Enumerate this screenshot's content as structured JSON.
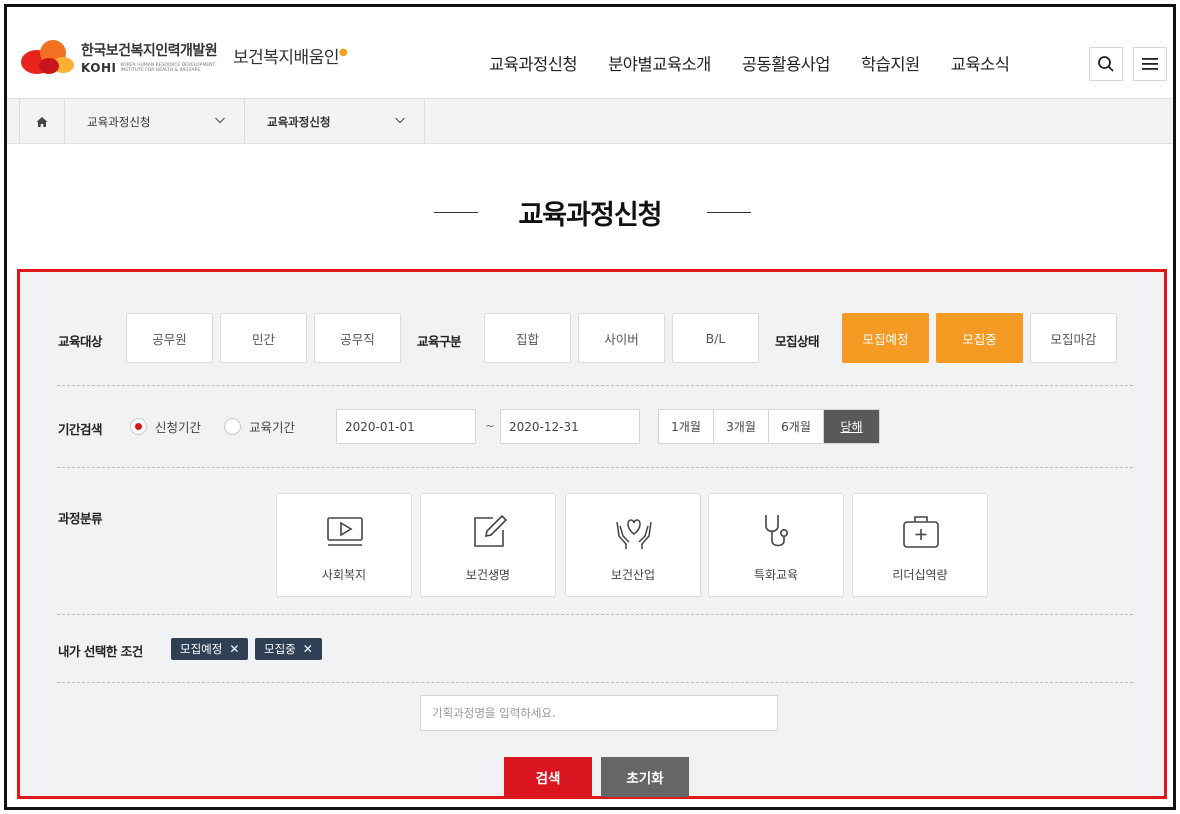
{
  "header": {
    "org_name_kr": "한국보건복지인력개발원",
    "org_name_en": "KOHI",
    "org_sub_en": "KOREA HUMAN RESOURCE DEVELOPMENT INSTITUTE FOR HEALTH & WELFARE",
    "service_name": "보건복지배움인",
    "nav": [
      "교육과정신청",
      "분야별교육소개",
      "공동활용사업",
      "학습지원",
      "교육소식"
    ]
  },
  "breadcrumb": {
    "items": [
      "교육과정신청",
      "교육과정신청"
    ]
  },
  "page_title": "교육과정신청",
  "filters": {
    "target": {
      "label": "교육대상",
      "options": [
        "공무원",
        "민간",
        "공무직"
      ]
    },
    "type": {
      "label": "교육구분",
      "options": [
        "집합",
        "사이버",
        "B/L"
      ]
    },
    "status": {
      "label": "모집상태",
      "options": [
        "모집예정",
        "모집중",
        "모집마감"
      ],
      "selected": [
        "모집예정",
        "모집중"
      ]
    },
    "period": {
      "label": "기간검색",
      "radio_options": [
        "신청기간",
        "교육기간"
      ],
      "selected_radio": "신청기간",
      "start_date": "2020-01-01",
      "separator": "~",
      "end_date": "2020-12-31",
      "quick_ranges": [
        "1개월",
        "3개월",
        "6개월",
        "당해"
      ],
      "selected_range": "당해"
    },
    "category": {
      "label": "과정분류",
      "items": [
        {
          "label": "사회복지",
          "icon": "video-play-icon"
        },
        {
          "label": "보건생명",
          "icon": "edit-pen-icon"
        },
        {
          "label": "보건산업",
          "icon": "heart-hands-icon"
        },
        {
          "label": "특화교육",
          "icon": "stethoscope-icon"
        },
        {
          "label": "리더십역량",
          "icon": "medical-kit-icon"
        }
      ]
    },
    "selected_conditions": {
      "label": "내가 선택한 조건",
      "tags": [
        "모집예정",
        "모집중"
      ]
    },
    "search": {
      "placeholder": "기획과정명을 입력하세요.",
      "search_label": "검색",
      "reset_label": "초기화"
    }
  },
  "colors": {
    "accent_orange": "#f59a22",
    "highlight_red": "#e01818",
    "search_button": "#d9161f",
    "reset_button": "#666666",
    "tag_bg": "#2f4054"
  }
}
